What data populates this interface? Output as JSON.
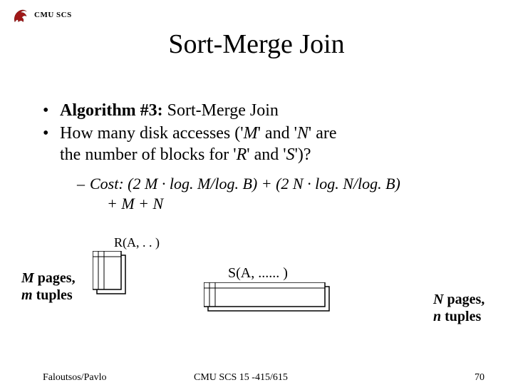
{
  "header": {
    "org": "CMU SCS",
    "logo_name": "dragon-logo"
  },
  "title": "Sort-Merge Join",
  "bullets": {
    "b1_prefix": "Algorithm #3:",
    "b1_rest": " Sort-Merge Join",
    "b2_line1": "How many disk accesses ('",
    "b2_M": "M",
    "b2_mid1": "' and '",
    "b2_N": "N",
    "b2_mid2": "' are",
    "b2_line2_a": "the number of blocks for '",
    "b2_R": "R",
    "b2_mid3": "' and '",
    "b2_S": "S",
    "b2_end": "')?"
  },
  "cost": {
    "line1": "Cost: (2 M · log. M/log. B) + (2 N · log. N/log. B)",
    "line2": "+ M + N"
  },
  "diagram": {
    "r_label": "R(A, . . )",
    "s_label": "S(A, ...... )",
    "m_label_l1": "M",
    "m_label_l1b": " pages,",
    "m_label_l2": "m",
    "m_label_l2b": " tuples",
    "n_label_l1": "N",
    "n_label_l1b": " pages,",
    "n_label_l2": "n",
    "n_label_l2b": " tuples"
  },
  "footer": {
    "left": "Faloutsos/Pavlo",
    "mid": "CMU SCS 15 -415/615",
    "right": "70"
  }
}
